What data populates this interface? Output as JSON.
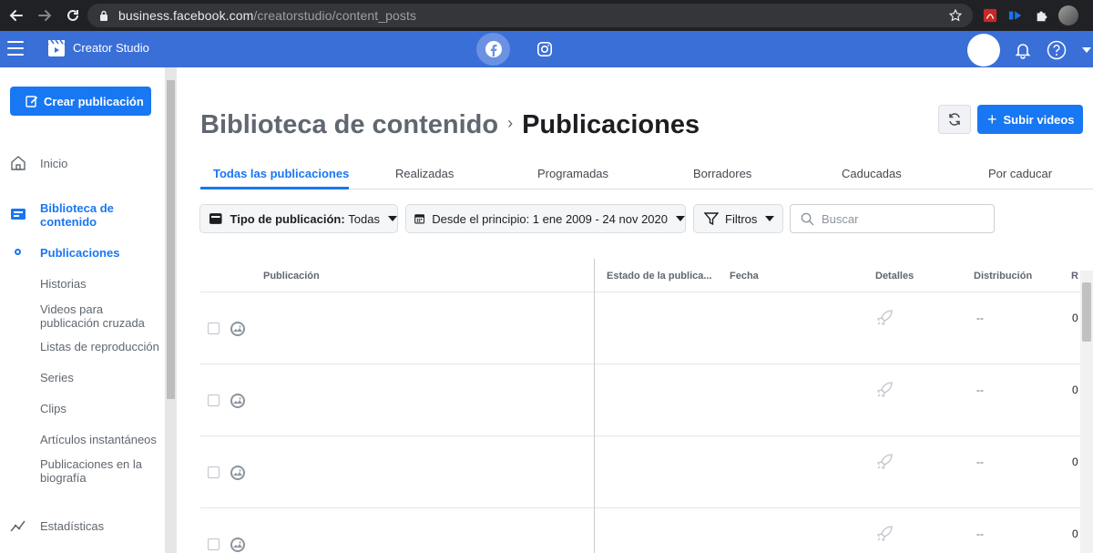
{
  "browser": {
    "url_host": "business.facebook.com",
    "url_path": "/creatorstudio/content_posts"
  },
  "header": {
    "title": "Creator Studio",
    "platform_tabs": [
      "facebook-icon",
      "instagram-icon"
    ]
  },
  "sidebar": {
    "create_label": "Crear publicación",
    "items": [
      {
        "label": "Inicio"
      },
      {
        "label": "Biblioteca de contenido"
      },
      {
        "label": "Publicaciones"
      },
      {
        "label": "Historias"
      },
      {
        "label": "Videos para publicación cruzada"
      },
      {
        "label": "Listas de reproducción"
      },
      {
        "label": "Series"
      },
      {
        "label": "Clips"
      },
      {
        "label": "Artículos instantáneos"
      },
      {
        "label": "Publicaciones en la biografía"
      },
      {
        "label": "Estadísticas"
      }
    ]
  },
  "page": {
    "breadcrumb_parent": "Biblioteca de contenido",
    "breadcrumb_current": "Publicaciones",
    "upload_label": "Subir videos"
  },
  "tabs": [
    {
      "label": "Todas las publicaciones",
      "active": true
    },
    {
      "label": "Realizadas"
    },
    {
      "label": "Programadas"
    },
    {
      "label": "Borradores"
    },
    {
      "label": "Caducadas"
    },
    {
      "label": "Por caducar"
    }
  ],
  "filters": {
    "type_label": "Tipo de publicación:",
    "type_value": "Todas",
    "date_range": "Desde el principio: 1 ene 2009 - 24 nov 2020",
    "filters_label": "Filtros",
    "search_placeholder": "Buscar"
  },
  "table": {
    "columns": [
      "Publicación",
      "Estado de la publica...",
      "Fecha",
      "Detalles",
      "Distribución",
      "R"
    ],
    "rows": [
      {
        "distribution": "--",
        "value": "0"
      },
      {
        "distribution": "--",
        "value": "0"
      },
      {
        "distribution": "--",
        "value": "0"
      },
      {
        "distribution": "--",
        "value": "0"
      }
    ]
  },
  "colors": {
    "brand_blue": "#1877f2",
    "appbar_blue": "#3a6fd8",
    "chrome_dark": "#202124"
  }
}
